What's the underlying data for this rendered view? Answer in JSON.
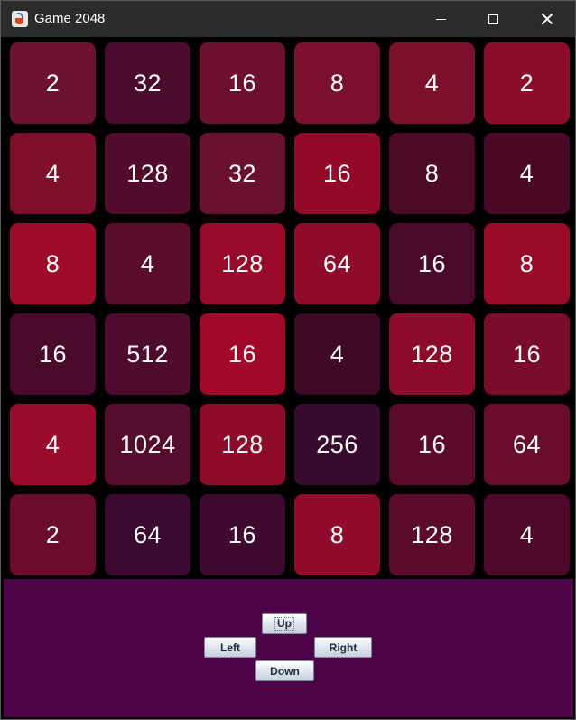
{
  "window": {
    "title": "Game 2048"
  },
  "colors": {
    "background": "#000000",
    "control_panel": "#4d0347",
    "tile_text": "#ffffff"
  },
  "board": {
    "rows": [
      [
        "2",
        "32",
        "16",
        "8",
        "4",
        "2"
      ],
      [
        "4",
        "128",
        "32",
        "16",
        "8",
        "4"
      ],
      [
        "8",
        "4",
        "128",
        "64",
        "16",
        "8"
      ],
      [
        "16",
        "512",
        "16",
        "4",
        "128",
        "16"
      ],
      [
        "4",
        "1024",
        "128",
        "256",
        "16",
        "64"
      ],
      [
        "2",
        "64",
        "16",
        "8",
        "128",
        "4"
      ]
    ],
    "tile_colors": [
      [
        "#6c1232",
        "#4a0c2c",
        "#6e1030",
        "#7a0f2e",
        "#7c0f2c",
        "#8e0c2c"
      ],
      [
        "#7e0e2a",
        "#520b2a",
        "#6a1030",
        "#930a28",
        "#4e0b28",
        "#4a0a26"
      ],
      [
        "#9e0a28",
        "#5a0c2c",
        "#990a2a",
        "#8e0b2a",
        "#4a0a2a",
        "#980a28"
      ],
      [
        "#4a0a2c",
        "#4e0b2c",
        "#a2082a",
        "#3f0a26",
        "#8c0b2c",
        "#7c0c2c"
      ],
      [
        "#9a0a2a",
        "#560c2c",
        "#8e0b2a",
        "#380a2c",
        "#5a0b2c",
        "#6a0c2e"
      ],
      [
        "#6c0c2c",
        "#3c0a30",
        "#3e0a2e",
        "#900b2c",
        "#5c0b2c",
        "#4e0a28"
      ]
    ]
  },
  "controls": {
    "up": "Up",
    "left": "Left",
    "right": "Right",
    "down": "Down"
  }
}
